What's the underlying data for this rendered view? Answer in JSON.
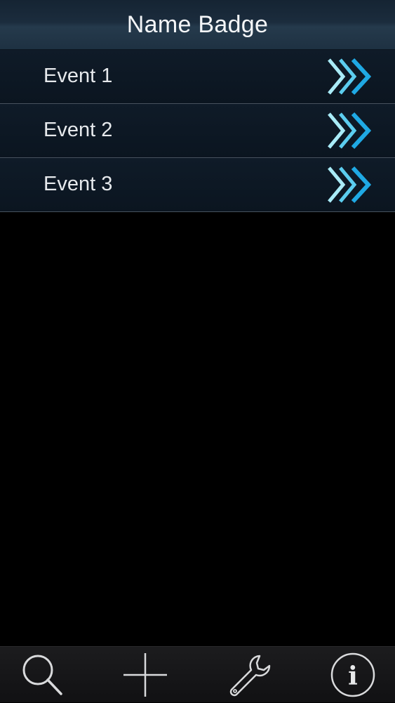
{
  "header": {
    "title": "Name Badge"
  },
  "events": [
    {
      "label": "Event 1"
    },
    {
      "label": "Event 2"
    },
    {
      "label": "Event 3"
    }
  ],
  "toolbar": {
    "items": [
      {
        "icon": "search-icon"
      },
      {
        "icon": "plus-icon"
      },
      {
        "icon": "wrench-icon"
      },
      {
        "icon": "info-icon",
        "glyph": "i"
      }
    ]
  },
  "colors": {
    "accent": "#2fb6e8",
    "accent_light": "#8fe0f4",
    "background": "#000000",
    "row_background": "#0d1824"
  }
}
